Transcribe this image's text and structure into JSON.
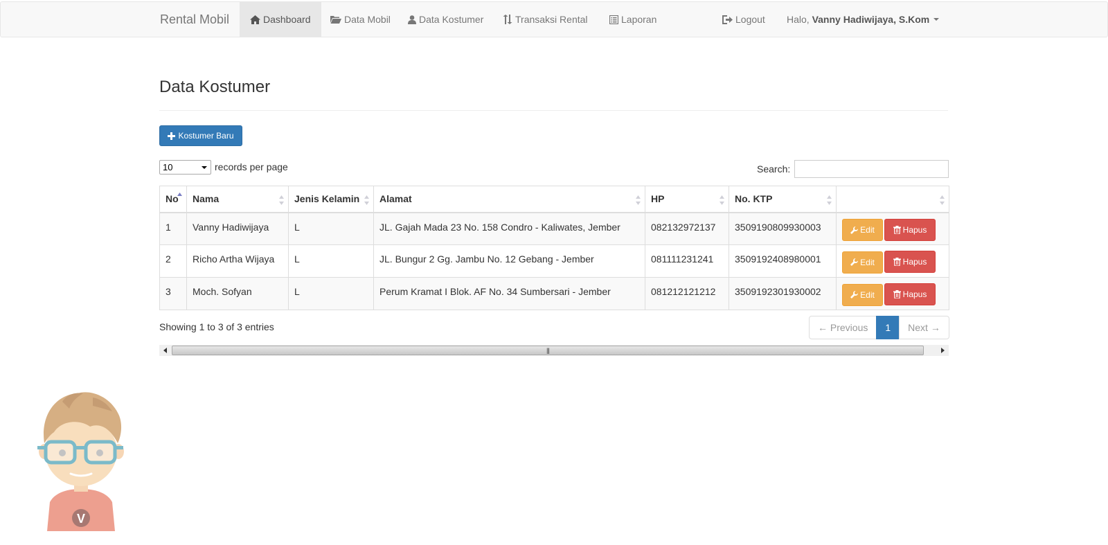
{
  "navbar": {
    "brand": "Rental Mobil",
    "items": [
      {
        "label": "Dashboard",
        "icon": "home-icon",
        "active": true
      },
      {
        "label": "Data Mobil",
        "icon": "folder-open-icon"
      },
      {
        "label": "Data Kostumer",
        "icon": "user-icon"
      },
      {
        "label": "Transaksi Rental",
        "icon": "sort-arrows-icon"
      },
      {
        "label": "Laporan",
        "icon": "list-alt-icon"
      }
    ],
    "logout": {
      "label": "Logout",
      "icon": "logout-icon"
    },
    "user": {
      "greeting": "Halo,",
      "name": "Vanny Hadiwijaya, S.Kom"
    }
  },
  "page": {
    "title": "Data Kostumer",
    "new_button": "Kostumer Baru"
  },
  "datatable": {
    "length_value": "10",
    "length_label": "records per page",
    "search_label": "Search:",
    "search_value": "",
    "columns": [
      "No",
      "Nama",
      "Jenis Kelamin",
      "Alamat",
      "HP",
      "No. KTP",
      ""
    ],
    "rows": [
      {
        "no": "1",
        "nama": "Vanny Hadiwijaya",
        "jk": "L",
        "alamat": "JL. Gajah Mada 23 No. 158 Condro - Kaliwates, Jember",
        "hp": "082132972137",
        "ktp": "3509190809930003"
      },
      {
        "no": "2",
        "nama": "Richo Artha Wijaya",
        "jk": "L",
        "alamat": "JL. Bungur 2 Gg. Jambu No. 12 Gebang - Jember",
        "hp": "081111231241",
        "ktp": "3509192408980001"
      },
      {
        "no": "3",
        "nama": "Moch. Sofyan",
        "jk": "L",
        "alamat": "Perum Kramat I Blok. AF No. 34 Sumbersari - Jember",
        "hp": "081212121212",
        "ktp": "3509192301930002"
      }
    ],
    "edit_label": "Edit",
    "delete_label": "Hapus",
    "info": "Showing 1 to 3 of 3 entries",
    "pagination": {
      "previous": "← Previous",
      "current": "1",
      "next": "Next →"
    }
  },
  "colors": {
    "primary": "#337ab7",
    "warning": "#f0ad4e",
    "danger": "#d9534f",
    "navbar_bg": "#f8f8f8"
  }
}
